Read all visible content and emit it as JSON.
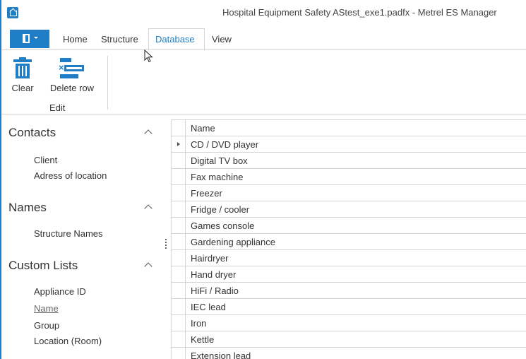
{
  "window": {
    "title": "Hospital Equipment Safety AStest_exe1.padfx - Metrel ES Manager"
  },
  "menu": {
    "tabs": [
      {
        "label": "Home"
      },
      {
        "label": "Structure"
      },
      {
        "label": "Database",
        "active": true
      },
      {
        "label": "View"
      }
    ]
  },
  "ribbon": {
    "buttons": [
      {
        "label": "Clear",
        "icon": "trash-icon"
      },
      {
        "label": "Delete row",
        "icon": "delete-row-icon"
      }
    ],
    "group_label": "Edit"
  },
  "sidebar": {
    "sections": [
      {
        "title": "Contacts",
        "items": [
          "Client",
          "Adress of location"
        ]
      },
      {
        "title": "Names",
        "items": [
          "Structure Names"
        ]
      },
      {
        "title": "Custom Lists",
        "items": [
          "Appliance ID",
          "Name",
          "Group",
          "Location (Room)"
        ],
        "selected": "Name"
      }
    ]
  },
  "grid": {
    "column_header": "Name",
    "rows": [
      "CD / DVD player",
      "Digital TV box",
      "Fax machine",
      "Freezer",
      "Fridge / cooler",
      "Games console",
      "Gardening appliance",
      "Hairdryer",
      "Hand dryer",
      "HiFi / Radio",
      "IEC lead",
      "Iron",
      "Kettle",
      "Extension lead"
    ],
    "current_row": 0
  },
  "colors": {
    "accent": "#1e7fc8",
    "border": "#d4d4d4"
  }
}
